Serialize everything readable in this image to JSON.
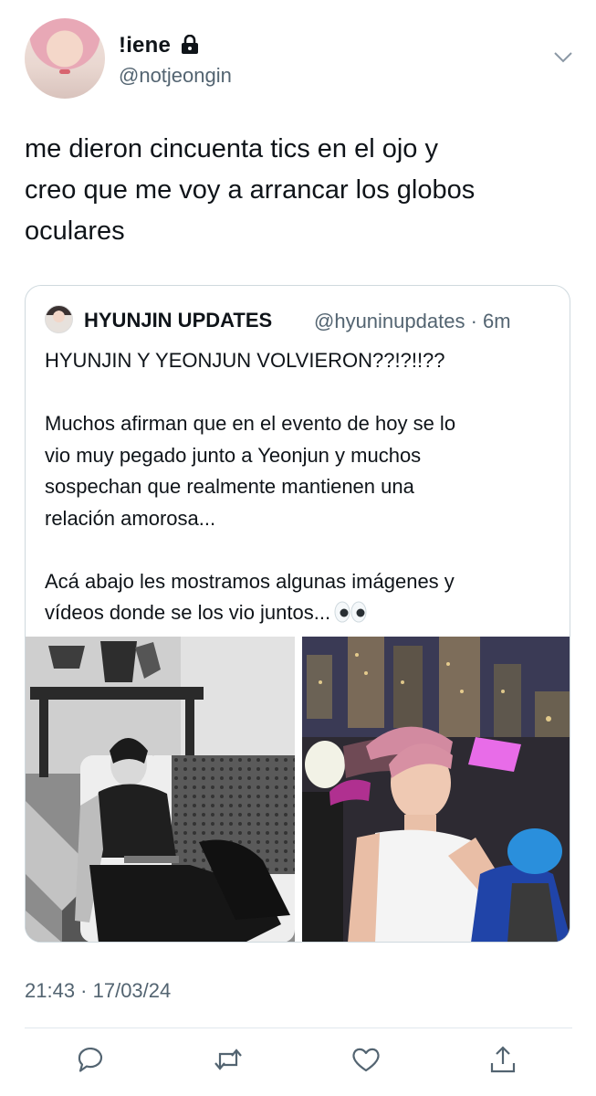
{
  "author": {
    "display_name": "!iene",
    "handle": "@notjeongin"
  },
  "tweet": {
    "text": "me dieron cincuenta tics en el ojo y\ncreo que me voy a arrancar los globos\noculares",
    "timestamp": "21:43 · 17/03/24"
  },
  "quoted": {
    "display_name": "HYUNJIN UPDATES",
    "handle_time": "@hyuninupdates · 6m",
    "text": "HYUNJIN Y YEONJUN VOLVIERON??!?!!??\n\nMuchos afirman que en el evento de hoy se lo\nvio muy pegado junto a Yeonjun y muchos\nsospechan que realmente mantienen una\nrelación amorosa...\n\nAcá abajo les mostramos algunas imágenes y\nvídeos donde se los vio juntos...",
    "emoji": "eyes-emoji"
  },
  "icons": {
    "lock": "lock-icon",
    "menu": "chevron-down-icon",
    "reply": "reply-icon",
    "retweet": "retweet-icon",
    "like": "heart-icon",
    "share": "share-icon"
  },
  "colors": {
    "text": "#0f1419",
    "secondary": "#536471",
    "border": "#cfd9de"
  }
}
